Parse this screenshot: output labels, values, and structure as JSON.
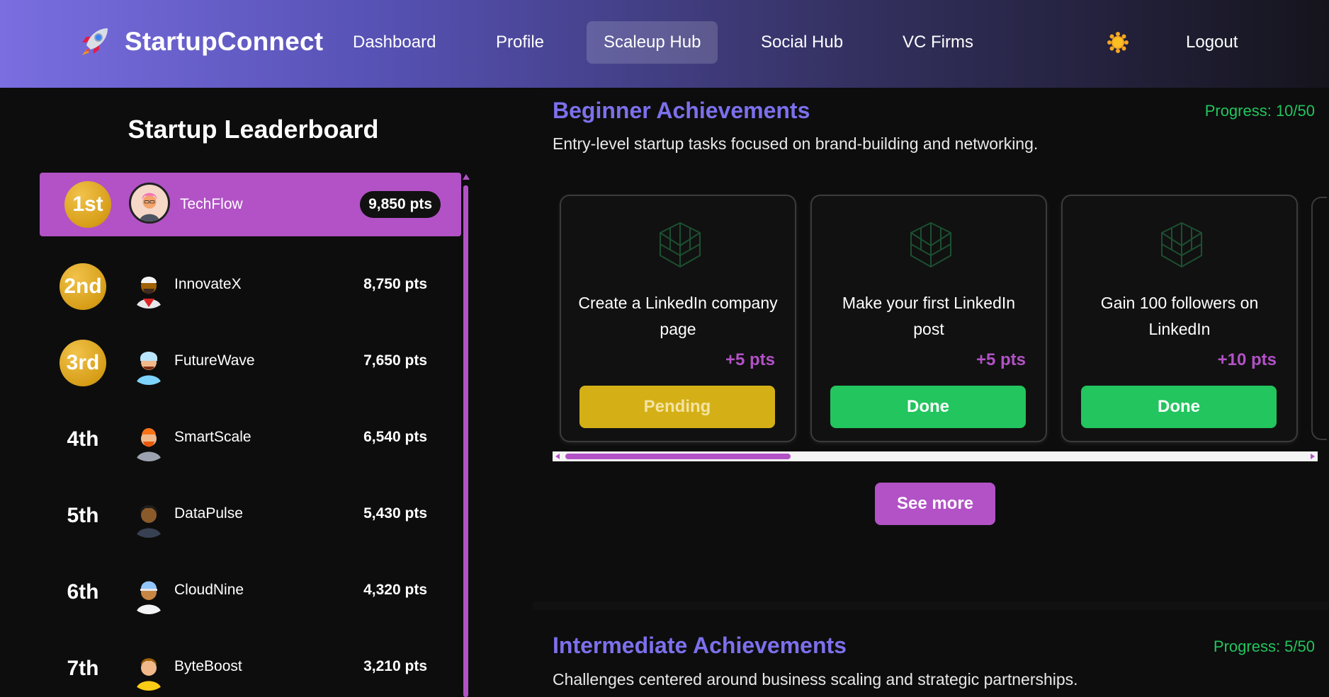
{
  "nav": {
    "brand": "StartupConnect",
    "links": [
      "Dashboard",
      "Profile",
      "Scaleup Hub",
      "Social Hub",
      "VC Firms"
    ],
    "active": "Scaleup Hub",
    "logout": "Logout"
  },
  "leaderboard": {
    "title": "Startup Leaderboard",
    "rows": [
      {
        "rank": "1st",
        "name": "TechFlow",
        "points": "9,850 pts"
      },
      {
        "rank": "2nd",
        "name": "InnovateX",
        "points": "8,750 pts"
      },
      {
        "rank": "3rd",
        "name": "FutureWave",
        "points": "7,650 pts"
      },
      {
        "rank": "4th",
        "name": "SmartScale",
        "points": "6,540 pts"
      },
      {
        "rank": "5th",
        "name": "DataPulse",
        "points": "5,430 pts"
      },
      {
        "rank": "6th",
        "name": "CloudNine",
        "points": "4,320 pts"
      },
      {
        "rank": "7th",
        "name": "ByteBoost",
        "points": "3,210 pts"
      }
    ]
  },
  "beginner": {
    "title": "Beginner Achievements",
    "progress": "Progress: 10/50",
    "description": "Entry-level startup tasks focused on brand-building and networking.",
    "cards": [
      {
        "task": "Create a LinkedIn company page",
        "reward": "+5 pts",
        "status": "Pending"
      },
      {
        "task": "Make your first LinkedIn post",
        "reward": "+5 pts",
        "status": "Done"
      },
      {
        "task": "Gain 100 followers on LinkedIn",
        "reward": "+10 pts",
        "status": "Done"
      }
    ],
    "see_more": "See more"
  },
  "intermediate": {
    "title": "Intermediate Achievements",
    "progress": "Progress: 5/50",
    "description": "Challenges centered around business scaling and strategic partnerships."
  },
  "colors": {
    "accent": "#b252c6",
    "title": "#7c70ec",
    "success": "#22c55e",
    "pending": "#d4b016",
    "medal": "#d79e18"
  }
}
